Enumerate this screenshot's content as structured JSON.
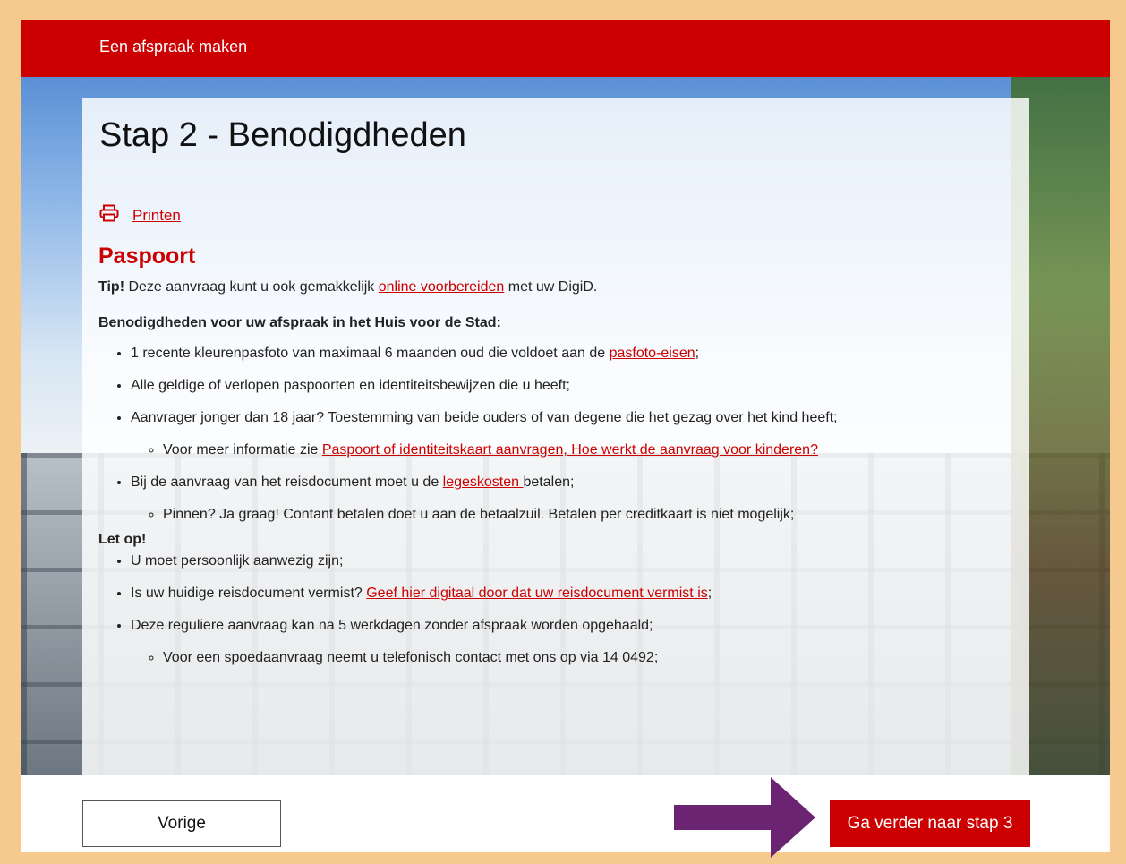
{
  "topbar": {
    "title": "Een afspraak maken"
  },
  "page": {
    "title": "Stap 2 - Benodigdheden",
    "print_label": "Printen",
    "section_title": "Paspoort"
  },
  "content": {
    "tip_bold": "Tip!",
    "tip_text1": " Deze aanvraag kunt u ook gemakkelijk ",
    "tip_link": "online voorbereiden",
    "tip_text2": " met uw DigiD.",
    "requirements_heading": "Benodigdheden voor uw afspraak in het Huis voor de Stad:",
    "req1_text": "1 recente kleurenpasfoto van maximaal 6 maanden oud die voldoet aan de ",
    "req1_link": "pasfoto-eisen",
    "req1_end": ";",
    "req2_text": "Alle geldige of verlopen paspoorten en identiteitsbewijzen die u heeft;",
    "req3_text": "Aanvrager jonger dan 18 jaar? Toestemming van beide ouders of van degene die het gezag over het kind heeft;",
    "req3_sub_text": "Voor meer informatie zie ",
    "req3_sub_link": "Paspoort of identiteitskaart aanvragen, Hoe werkt de aanvraag voor kinderen?",
    "req4_text": "Bij de aanvraag van het reisdocument moet u de ",
    "req4_link": "legeskosten ",
    "req4_end": "betalen;",
    "req4_sub_text": "Pinnen? Ja graag! Contant betalen doet u aan de betaalzuil. Betalen per creditkaart is niet mogelijk;",
    "letop_heading": "Let op!",
    "note1_text": "U moet persoonlijk aanwezig zijn;",
    "note2_text": "Is uw huidige reisdocument vermist? ",
    "note2_link": "Geef hier digitaal door dat uw reisdocument vermist is",
    "note2_end": ";",
    "note3_text": "Deze reguliere aanvraag kan na 5 werkdagen zonder afspraak worden opgehaald;",
    "note3_sub_text": "Voor een spoedaanvraag neemt u telefonisch contact met ons op via 14 0492;"
  },
  "footer": {
    "prev_label": "Vorige",
    "next_label": "Ga verder naar stap 3"
  },
  "colors": {
    "brand_red": "#cc0000",
    "frame_border": "#f6c98f",
    "arrow_purple": "#6b2472"
  },
  "icons": {
    "print": "printer-icon",
    "annotation": "arrow-right-icon"
  }
}
